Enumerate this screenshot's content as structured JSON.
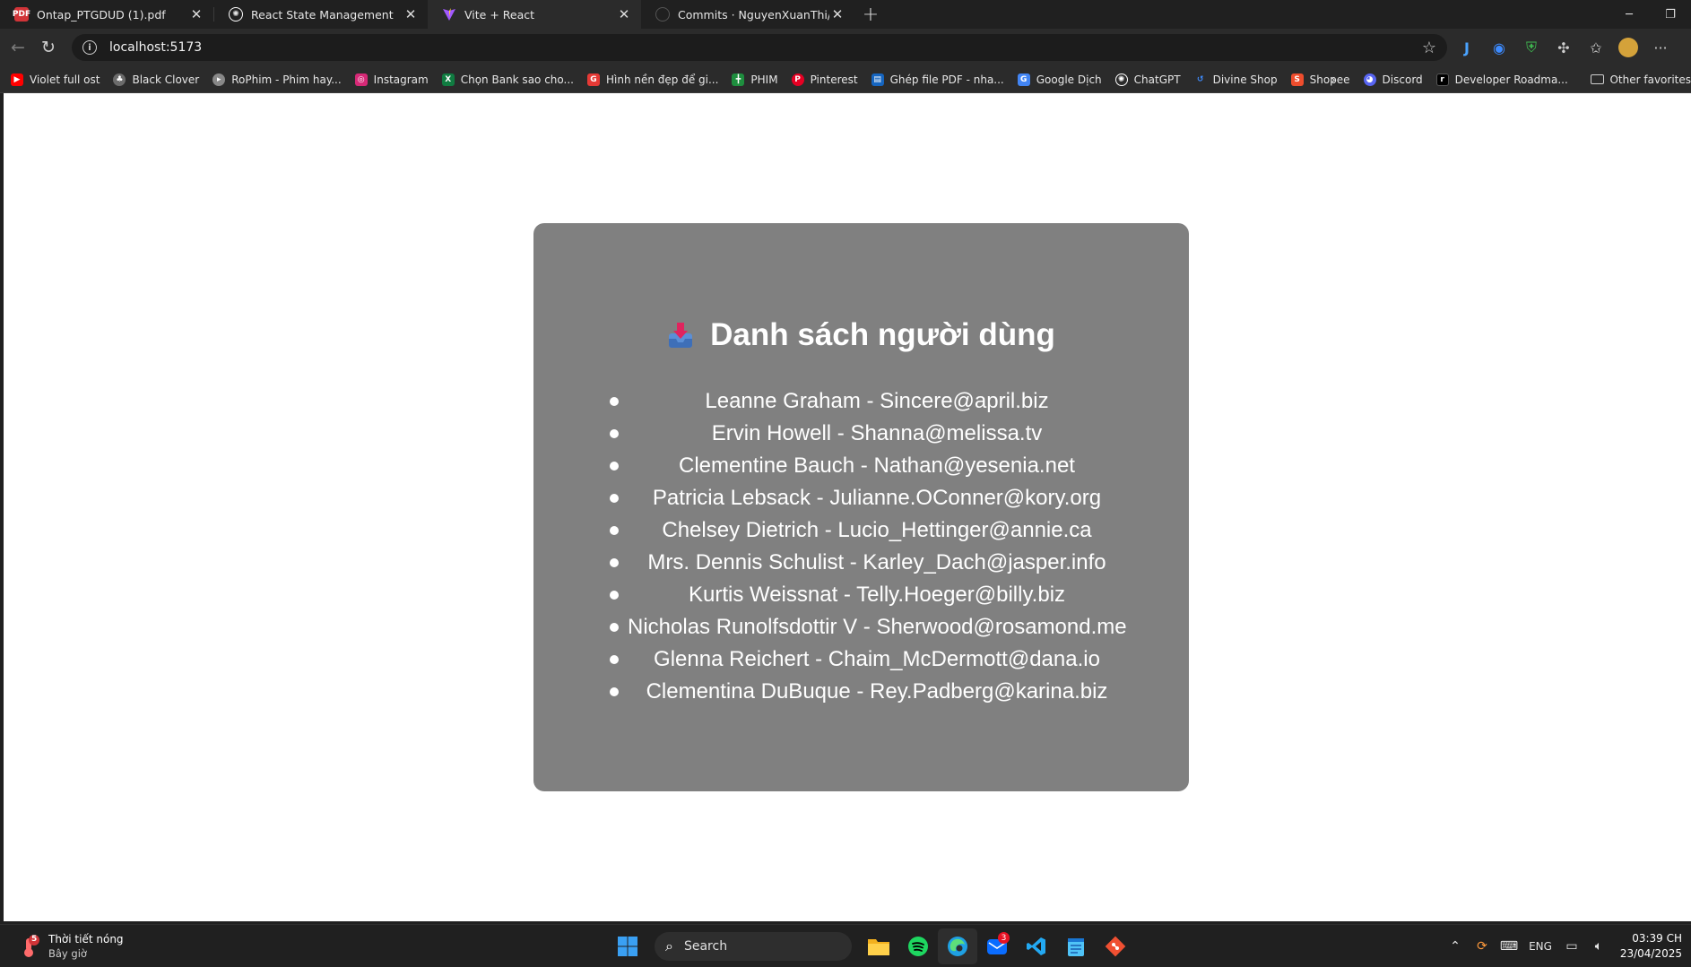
{
  "browser": {
    "tabs": [
      {
        "title": "Ontap_PTGDUD (1).pdf",
        "icon": "pdf-icon",
        "color": "#d13438",
        "active": false
      },
      {
        "title": "React State Management",
        "icon": "openai-icon",
        "color": "#ffffff",
        "active": false
      },
      {
        "title": "Vite + React",
        "icon": "vite-icon",
        "color": "#a259ff",
        "active": true
      },
      {
        "title": "Commits · NguyenXuanThi/REACT",
        "icon": "github-icon",
        "color": "#ffffff",
        "active": false
      }
    ],
    "address_url": "localhost:5173",
    "bookmarks": [
      {
        "label": "Violet full ost",
        "icon": "youtube-icon",
        "color": "#ff0000"
      },
      {
        "label": "Black Clover",
        "icon": "black-clover-icon",
        "color": "#6b6b6b"
      },
      {
        "label": "RoPhim - Phim hay...",
        "icon": "rophim-icon",
        "color": "#888888"
      },
      {
        "label": "Instagram",
        "icon": "instagram-icon",
        "color": "#d62976"
      },
      {
        "label": "Chọn Bank sao cho...",
        "icon": "excel-icon",
        "color": "#107c41"
      },
      {
        "label": "Hình nền đẹp để gi...",
        "icon": "g-icon",
        "color": "#e53935"
      },
      {
        "label": "PHIM",
        "icon": "sheets-icon",
        "color": "#1e8e3e"
      },
      {
        "label": "Pinterest",
        "icon": "pinterest-icon",
        "color": "#e60023"
      },
      {
        "label": "Ghép file PDF - nha...",
        "icon": "pdf-merge-icon",
        "color": "#1565c0"
      },
      {
        "label": "Google Dịch",
        "icon": "google-translate-icon",
        "color": "#4285f4"
      },
      {
        "label": "ChatGPT",
        "icon": "chatgpt-icon",
        "color": "#ffffff"
      },
      {
        "label": "Divine Shop",
        "icon": "divine-shop-icon",
        "color": "#3f8cff"
      },
      {
        "label": "Shopee",
        "icon": "shopee-icon",
        "color": "#ee4d2d"
      },
      {
        "label": "Discord",
        "icon": "discord-icon",
        "color": "#5865f2"
      },
      {
        "label": "Developer Roadma...",
        "icon": "roadmap-icon",
        "color": "#000000"
      }
    ],
    "other_favorites": "Other favorites"
  },
  "page": {
    "heading": "Danh sách người dùng",
    "users": [
      "Leanne Graham - Sincere@april.biz",
      "Ervin Howell - Shanna@melissa.tv",
      "Clementine Bauch - Nathan@yesenia.net",
      "Patricia Lebsack - Julianne.OConner@kory.org",
      "Chelsey Dietrich - Lucio_Hettinger@annie.ca",
      "Mrs. Dennis Schulist - Karley_Dach@jasper.info",
      "Kurtis Weissnat - Telly.Hoeger@billy.biz",
      "Nicholas Runolfsdottir V - Sherwood@rosamond.me",
      "Glenna Reichert - Chaim_McDermott@dana.io",
      "Clementina DuBuque - Rey.Padberg@karina.biz"
    ],
    "card_color": "#808080"
  },
  "taskbar": {
    "weather_title": "Thời tiết nóng",
    "weather_sub": "Bây giờ",
    "weather_badge": "5",
    "search_placeholder": "Search",
    "mail_badge": "3",
    "lang": "ENG",
    "time": "03:39 CH",
    "date": "23/04/2025"
  }
}
